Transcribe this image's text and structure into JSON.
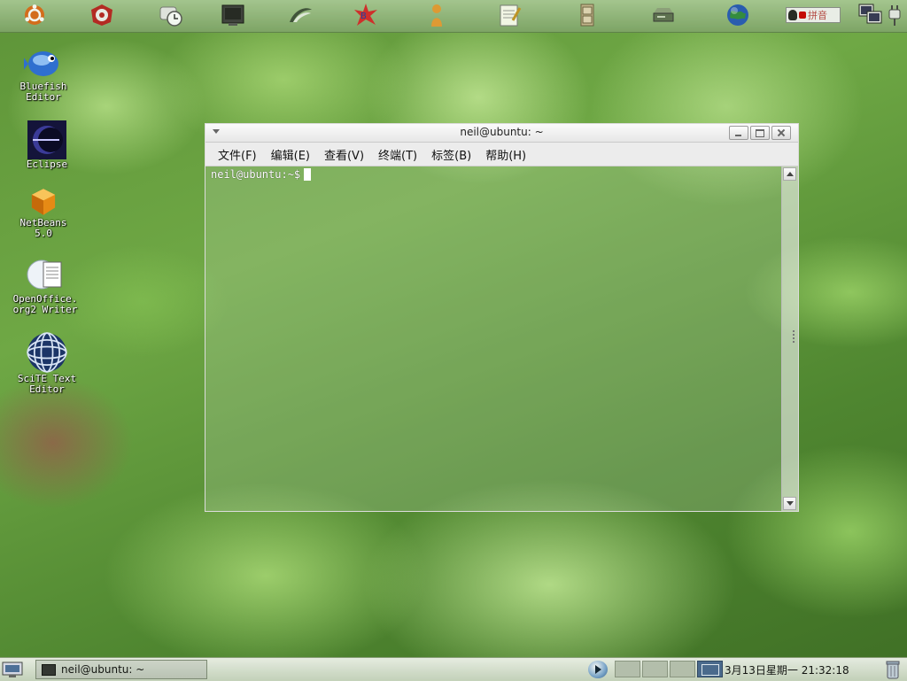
{
  "top_panel": {
    "launchers": [
      {
        "icon": "ubuntu-menu-icon"
      },
      {
        "icon": "biohazard-icon"
      },
      {
        "icon": "clock-settings-icon"
      },
      {
        "icon": "terminal-monitor-icon"
      },
      {
        "icon": "wing-swoosh-icon"
      },
      {
        "icon": "star-blast-icon"
      },
      {
        "icon": "person-figure-icon"
      },
      {
        "icon": "notepad-icon"
      },
      {
        "icon": "filing-cabinet-icon"
      },
      {
        "icon": "drive-icon"
      },
      {
        "icon": "globe-icon"
      }
    ],
    "ime_label": "拼音",
    "network_icon": "network-monitor-icon",
    "power_icon": "power-plug-icon"
  },
  "desktop_icons": [
    {
      "label": "Bluefish\nEditor",
      "icon": "bluefish-icon"
    },
    {
      "label": "Eclipse",
      "icon": "eclipse-icon"
    },
    {
      "label": "NetBeans\n5.0",
      "icon": "netbeans-cube-icon"
    },
    {
      "label": "OpenOffice.\norg2 Writer",
      "icon": "writer-document-icon"
    },
    {
      "label": "SciTE Text\nEditor",
      "icon": "scite-sphere-icon"
    }
  ],
  "terminal": {
    "title": "neil@ubuntu: ~",
    "menu": [
      "文件(F)",
      "编辑(E)",
      "查看(V)",
      "终端(T)",
      "标签(B)",
      "帮助(H)"
    ],
    "prompt": "neil@ubuntu:~$"
  },
  "bottom_panel": {
    "task_label": "neil@ubuntu: ~",
    "clock": "3月13日星期一  21:32:18",
    "workspaces": 4,
    "active_workspace": 4
  }
}
